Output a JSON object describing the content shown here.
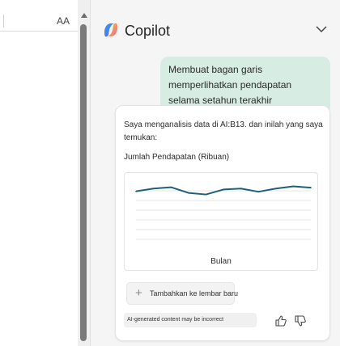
{
  "sheet": {
    "column_header": "AA"
  },
  "copilot": {
    "title": "Copilot",
    "user_message": "Membuat bagan garis memperlihatkan pendapatan selama setahun terakhir",
    "response": {
      "analysis_text": "Saya menganalisis data di AI:B13. dan inilah yang saya temukan:",
      "chart_title": "Jumlah Pendapatan (Ribuan)",
      "add_button_label": "Tambahkan ke lembar baru",
      "ai_disclaimer": "AI-generated content may be incorrect"
    }
  },
  "colors": {
    "line": "#1f5f7a",
    "user_bubble": "#d7ece3",
    "grid": "#e6e6e6"
  },
  "chart_data": {
    "type": "line",
    "title": "Jumlah Pendapatan (Ribuan)",
    "xlabel": "Bulan",
    "ylabel": "",
    "grid": true,
    "legend": "none",
    "x": [
      1,
      2,
      3,
      4,
      5,
      6,
      7,
      8,
      9,
      10,
      11
    ],
    "series": [
      {
        "values": [
          0.62,
          0.74,
          0.8,
          0.55,
          0.48,
          0.7,
          0.74,
          0.6,
          0.74,
          0.84,
          0.78
        ]
      }
    ],
    "ylim": [
      0,
      1
    ]
  }
}
